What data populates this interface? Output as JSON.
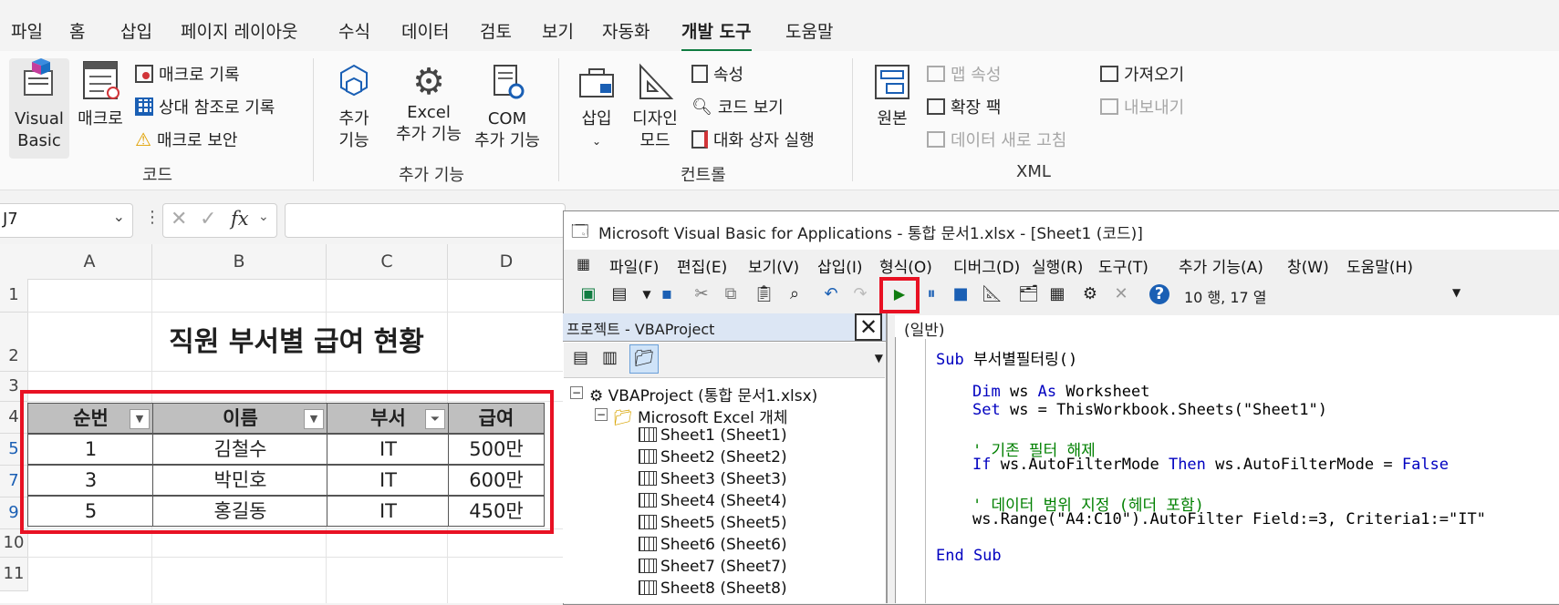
{
  "ribbon_tabs": [
    "파일",
    "홈",
    "삽입",
    "페이지 레이아웃",
    "수식",
    "데이터",
    "검토",
    "보기",
    "자동화",
    "개발 도구",
    "도움말"
  ],
  "ribbon": {
    "code_group": {
      "visual_basic": [
        "Visual",
        "Basic"
      ],
      "macro": "매크로",
      "record_macro": "매크로 기록",
      "relative_ref": "상대 참조로 기록",
      "macro_security": "매크로 보안",
      "label": "코드"
    },
    "addin_group": {
      "addins": [
        "추가",
        "기능"
      ],
      "excel_addins": [
        "Excel",
        "추가 기능"
      ],
      "com_addins": [
        "COM",
        "추가 기능"
      ],
      "label": "추가 기능"
    },
    "controls_group": {
      "insert": "삽입",
      "design_mode": [
        "디자인",
        "모드"
      ],
      "properties": "속성",
      "view_code": "코드 보기",
      "run_dialog": "대화 상자 실행",
      "label": "컨트롤"
    },
    "xml_group": {
      "source": "원본",
      "map_props": "맵 속성",
      "expansion": "확장 팩",
      "refresh": "데이터 새로 고침",
      "import": "가져오기",
      "export": "내보내기",
      "label": "XML"
    }
  },
  "formula_bar": {
    "name_box": "J7",
    "fx": "fx"
  },
  "sheet": {
    "columns": [
      "A",
      "B",
      "C",
      "D"
    ],
    "rows": [
      "1",
      "2",
      "3",
      "4",
      "5",
      "7",
      "9",
      "10",
      "11"
    ],
    "title": "직원 부서별 급여 현황",
    "headers": [
      "순번",
      "이름",
      "부서",
      "급여"
    ],
    "data": [
      [
        "1",
        "김철수",
        "IT",
        "500만"
      ],
      [
        "3",
        "박민호",
        "IT",
        "600만"
      ],
      [
        "5",
        "홍길동",
        "IT",
        "450만"
      ]
    ]
  },
  "vba": {
    "title": "Microsoft Visual Basic for Applications - 통합 문서1.xlsx - [Sheet1 (코드)]",
    "menus": [
      "파일(F)",
      "편집(E)",
      "보기(V)",
      "삽입(I)",
      "형식(O)",
      "디버그(D)",
      "실행(R)",
      "도구(T)",
      "추가 기능(A)",
      "창(W)",
      "도움말(H)"
    ],
    "position": "10 행, 17 열",
    "project_title": "프로젝트 - VBAProject",
    "project_root": "VBAProject (통합 문서1.xlsx)",
    "excel_objects": "Microsoft Excel 개체",
    "sheets": [
      "Sheet1 (Sheet1)",
      "Sheet2 (Sheet2)",
      "Sheet3 (Sheet3)",
      "Sheet4 (Sheet4)",
      "Sheet5 (Sheet5)",
      "Sheet6 (Sheet6)",
      "Sheet7 (Sheet7)",
      "Sheet8 (Sheet8)"
    ],
    "object_dropdown": "(일반)",
    "code": {
      "l1_kw": "Sub",
      "l1_rest": " 부서별필터링()",
      "l2_kw": "Dim",
      "l2_a": " ws ",
      "l2_kw2": "As",
      "l2_b": " Worksheet",
      "l3_kw": "Set",
      "l3_rest": " ws = ThisWorkbook.Sheets(\"Sheet1\")",
      "l4_cm": "' 기존 필터 해제",
      "l5_kw": "If",
      "l5_a": " ws.AutoFilterMode ",
      "l5_kw2": "Then",
      "l5_b": " ws.AutoFilterMode = ",
      "l5_kw3": "False",
      "l6_cm": "' 데이터 범위 지정 (헤더 포함)",
      "l7": "ws.Range(\"A4:C10\").AutoFilter Field:=3, Criteria1:=\"IT\"",
      "l8": "End Sub"
    }
  }
}
